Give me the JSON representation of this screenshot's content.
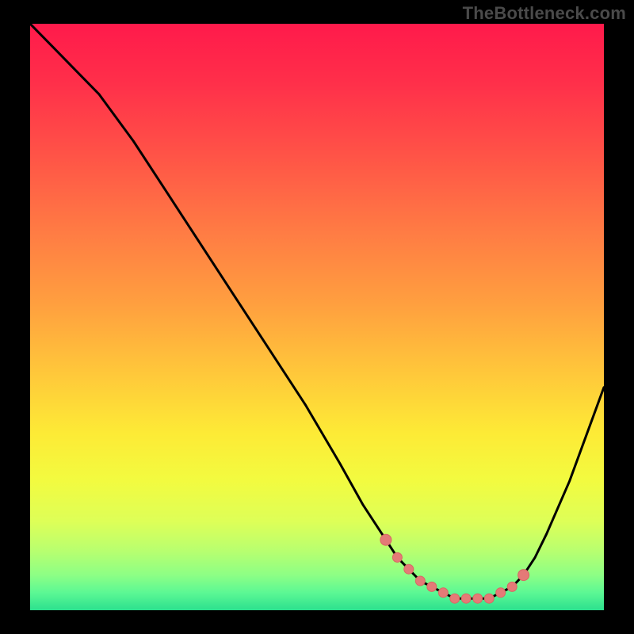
{
  "watermark": "TheBottleneck.com",
  "colors": {
    "curve_stroke": "#000000",
    "marker_fill": "#e47a77",
    "marker_stroke": "#d86863"
  },
  "gradient_stops": [
    {
      "offset": 0.0,
      "color": "#ff1a4b"
    },
    {
      "offset": 0.1,
      "color": "#ff2f4a"
    },
    {
      "offset": 0.22,
      "color": "#ff5247"
    },
    {
      "offset": 0.35,
      "color": "#ff7a44"
    },
    {
      "offset": 0.48,
      "color": "#ffa03f"
    },
    {
      "offset": 0.6,
      "color": "#ffc93a"
    },
    {
      "offset": 0.7,
      "color": "#fdeb36"
    },
    {
      "offset": 0.78,
      "color": "#f2fb40"
    },
    {
      "offset": 0.85,
      "color": "#ddff58"
    },
    {
      "offset": 0.9,
      "color": "#b7ff70"
    },
    {
      "offset": 0.94,
      "color": "#8dff85"
    },
    {
      "offset": 0.97,
      "color": "#5cf894"
    },
    {
      "offset": 1.0,
      "color": "#2ce08e"
    }
  ],
  "chart_data": {
    "type": "line",
    "title": "",
    "xlabel": "",
    "ylabel": "",
    "xlim": [
      0,
      100
    ],
    "ylim": [
      0,
      100
    ],
    "note": "Axes are not labeled in the image; x and y are normalized 0–100 (left→right, bottom→top). Curve traces an asymmetric V with minimum near x≈73.",
    "series": [
      {
        "name": "curve",
        "x": [
          0,
          4,
          8,
          12,
          18,
          24,
          30,
          36,
          42,
          48,
          54,
          58,
          62,
          64,
          66,
          68,
          70,
          72,
          74,
          76,
          78,
          80,
          82,
          84,
          86,
          88,
          90,
          94,
          100
        ],
        "y": [
          100,
          96,
          92,
          88,
          80,
          71,
          62,
          53,
          44,
          35,
          25,
          18,
          12,
          9,
          7,
          5,
          4,
          3,
          2,
          2,
          2,
          2,
          3,
          4,
          6,
          9,
          13,
          22,
          38
        ]
      }
    ],
    "markers": {
      "name": "highlight-dots",
      "x": [
        62,
        64,
        66,
        68,
        70,
        72,
        74,
        76,
        78,
        80,
        82,
        84,
        86
      ],
      "y": [
        12,
        9,
        7,
        5,
        4,
        3,
        2,
        2,
        2,
        2,
        3,
        4,
        6
      ]
    }
  }
}
